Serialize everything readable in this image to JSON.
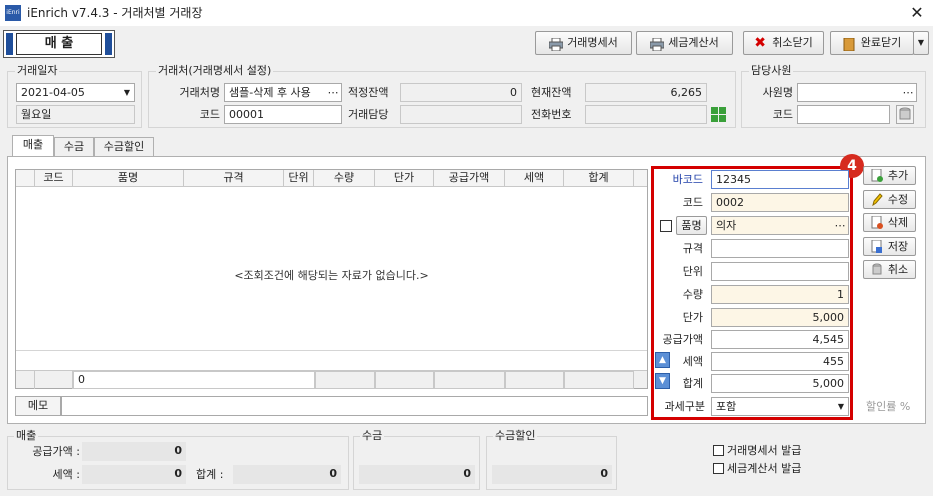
{
  "window": {
    "title": "iEnrich v7.4.3 - 거래처별 거래장",
    "logo_text": "iEnri"
  },
  "mode_label": "매 출",
  "toolbar": {
    "statement": "거래명세서",
    "tax_invoice": "세금계산서",
    "cancel_close": "취소닫기",
    "complete_close": "완료닫기"
  },
  "trade_date": {
    "group": "거래일자",
    "date": "2021-04-05",
    "weekday": "월요일"
  },
  "client": {
    "group": "거래처(거래명세서 설정)",
    "name_label": "거래처명",
    "name_value": "샘플-삭제 후 사용",
    "code_label": "코드",
    "code_value": "00001",
    "proper_balance_label": "적정잔액",
    "proper_balance_value": "0",
    "current_balance_label": "현재잔액",
    "current_balance_value": "6,265",
    "contact_label": "거래담당",
    "contact_value": "",
    "phone_label": "전화번호",
    "phone_value": ""
  },
  "staff": {
    "group": "담당사원",
    "name_label": "사원명",
    "name_value": "",
    "code_label": "코드",
    "code_value": ""
  },
  "tabs": [
    "매출",
    "수금",
    "수금할인"
  ],
  "grid": {
    "columns": [
      "코드",
      "품명",
      "규격",
      "단위",
      "수량",
      "단가",
      "공급가액",
      "세액",
      "합계"
    ],
    "empty_message": "<조회조건에 해당되는 자료가 없습니다.>",
    "footer_count": "0"
  },
  "memo_label": "메모",
  "form": {
    "badge": "4",
    "barcode_label": "바코드",
    "barcode": "12345",
    "code_label": "코드",
    "code": "0002",
    "item_label": "품명",
    "item": "의자",
    "spec_label": "규격",
    "spec": "",
    "unit_label": "단위",
    "unit": "",
    "qty_label": "수량",
    "qty": "1",
    "price_label": "단가",
    "price": "5,000",
    "supply_label": "공급가액",
    "supply": "4,545",
    "tax_label": "세액",
    "tax": "455",
    "total_label": "합계",
    "total": "5,000",
    "tax_type_label": "과세구분",
    "tax_type": "포함"
  },
  "side_buttons": {
    "add": "추가",
    "edit": "수정",
    "delete": "삭제",
    "save": "저장",
    "cancel": "취소"
  },
  "discount_rate": "할인률 %",
  "summary": {
    "sales_group": "매출",
    "supply_label": "공급가액 :",
    "supply": "0",
    "tax_label": "세액 :",
    "tax": "0",
    "total_label": "합계 :",
    "total": "0",
    "collect_group": "수금",
    "collect": "0",
    "discount_group": "수금할인",
    "discount": "0"
  },
  "issue": {
    "statement": "거래명세서 발급",
    "tax_invoice": "세금계산서 발급"
  },
  "colors": {
    "highlight": "#d40000",
    "badge": "#d62b1f",
    "mode_border": "#1f4e9a"
  }
}
